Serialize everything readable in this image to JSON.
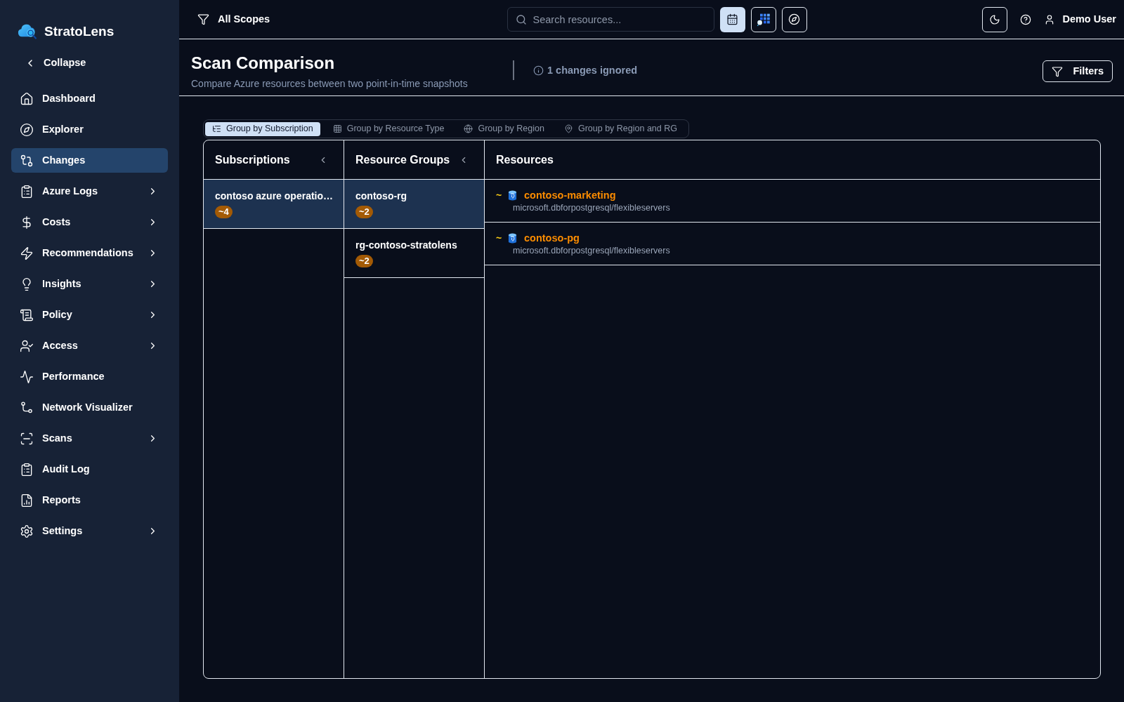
{
  "sidebar": {
    "brand": "StratoLens",
    "collapse": "Collapse",
    "items": [
      {
        "label": "Dashboard",
        "selected": false,
        "expandable": false
      },
      {
        "label": "Explorer",
        "selected": false,
        "expandable": false
      },
      {
        "label": "Changes",
        "selected": true,
        "expandable": false
      },
      {
        "label": "Azure Logs",
        "selected": false,
        "expandable": true
      },
      {
        "label": "Costs",
        "selected": false,
        "expandable": true
      },
      {
        "label": "Recommendations",
        "selected": false,
        "expandable": true
      },
      {
        "label": "Insights",
        "selected": false,
        "expandable": true
      },
      {
        "label": "Policy",
        "selected": false,
        "expandable": true
      },
      {
        "label": "Access",
        "selected": false,
        "expandable": true
      },
      {
        "label": "Performance",
        "selected": false,
        "expandable": false
      },
      {
        "label": "Network Visualizer",
        "selected": false,
        "expandable": false
      },
      {
        "label": "Scans",
        "selected": false,
        "expandable": true
      },
      {
        "label": "Audit Log",
        "selected": false,
        "expandable": false
      },
      {
        "label": "Reports",
        "selected": false,
        "expandable": false
      },
      {
        "label": "Settings",
        "selected": false,
        "expandable": true
      }
    ]
  },
  "topbar": {
    "scope": "All Scopes",
    "search": {
      "placeholder": "Search resources..."
    },
    "tools": [
      {
        "selected": true
      },
      {
        "selected": false
      },
      {
        "selected": false
      }
    ],
    "user": "Demo User"
  },
  "header": {
    "title": "Scan Comparison",
    "subtitle": "Compare Azure resources between two point-in-time snapshots",
    "ignored": "1 changes ignored",
    "filters": "Filters"
  },
  "grouping": [
    {
      "label": "Group by Subscription",
      "selected": true
    },
    {
      "label": "Group by Resource Type",
      "selected": false
    },
    {
      "label": "Group by Region",
      "selected": false
    },
    {
      "label": "Group by Region and RG",
      "selected": false
    }
  ],
  "columns": {
    "subscriptions": {
      "title": "Subscriptions",
      "items": [
        {
          "name": "contoso azure operatio…",
          "count": "~4",
          "selected": true
        }
      ]
    },
    "resource_groups": {
      "title": "Resource Groups",
      "items": [
        {
          "name": "contoso-rg",
          "count": "~2",
          "selected": true
        },
        {
          "name": "rg-contoso-stratolens",
          "count": "~2",
          "selected": false
        }
      ]
    },
    "resources": {
      "title": "Resources",
      "items": [
        {
          "marker": "~",
          "name": "contoso-marketing",
          "type": "microsoft.dbforpostgresql/flexibleservers"
        },
        {
          "marker": "~",
          "name": "contoso-pg",
          "type": "microsoft.dbforpostgresql/flexibleservers"
        }
      ]
    }
  }
}
